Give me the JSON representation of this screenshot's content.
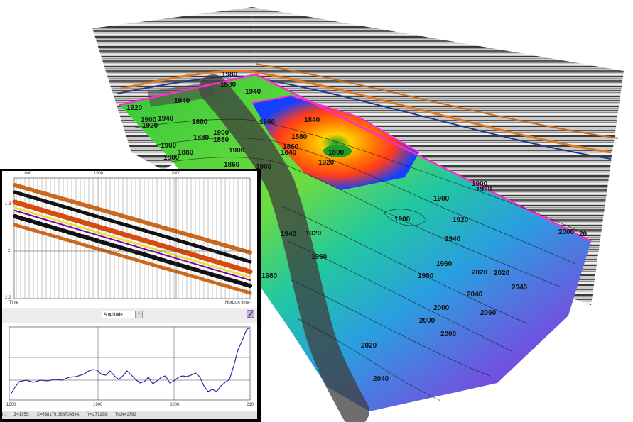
{
  "scene": {
    "contour_labels": [
      "1980",
      "1940",
      "1880",
      "1920",
      "1940",
      "1900",
      "1920",
      "1940",
      "1880",
      "1880",
      "1900",
      "1900",
      "1860",
      "1840",
      "1880",
      "1800",
      "1920",
      "1880",
      "1840",
      "1860",
      "1880",
      "1900",
      "1920",
      "1940",
      "1960",
      "1980",
      "1900",
      "1920",
      "1900",
      "1920",
      "1940",
      "1960",
      "1980",
      "2000",
      "2020",
      "2040",
      "2040",
      "2020",
      "2000",
      "2060",
      "2000",
      "2020",
      "2040",
      "1880",
      "1900",
      "1900",
      "1860",
      "2000",
      "20"
    ]
  },
  "inset": {
    "top_plot": {
      "x_ticks": [
        "1800",
        "1900",
        "2000"
      ],
      "y_ticks": [
        "1.8",
        "2",
        "2.2"
      ],
      "axis_left_label": "Time",
      "axis_right_label": "Horizon time",
      "axis_corner_label": "2.2"
    },
    "toolbar": {
      "attribute_select_value": "Amplitude",
      "paint_icon": "paint-brush-icon"
    },
    "amplitude_chart": {
      "x_ticks": [
        "1800",
        "1900",
        "2000",
        "210"
      ],
      "line_color": "#2a2aa0"
    },
    "status_bar": {
      "z": "Z=1958;",
      "x": "X=638179.066704694;",
      "y": "Y=277299;",
      "trace": "TrcN=1792",
      "prefix": "n; "
    }
  }
}
